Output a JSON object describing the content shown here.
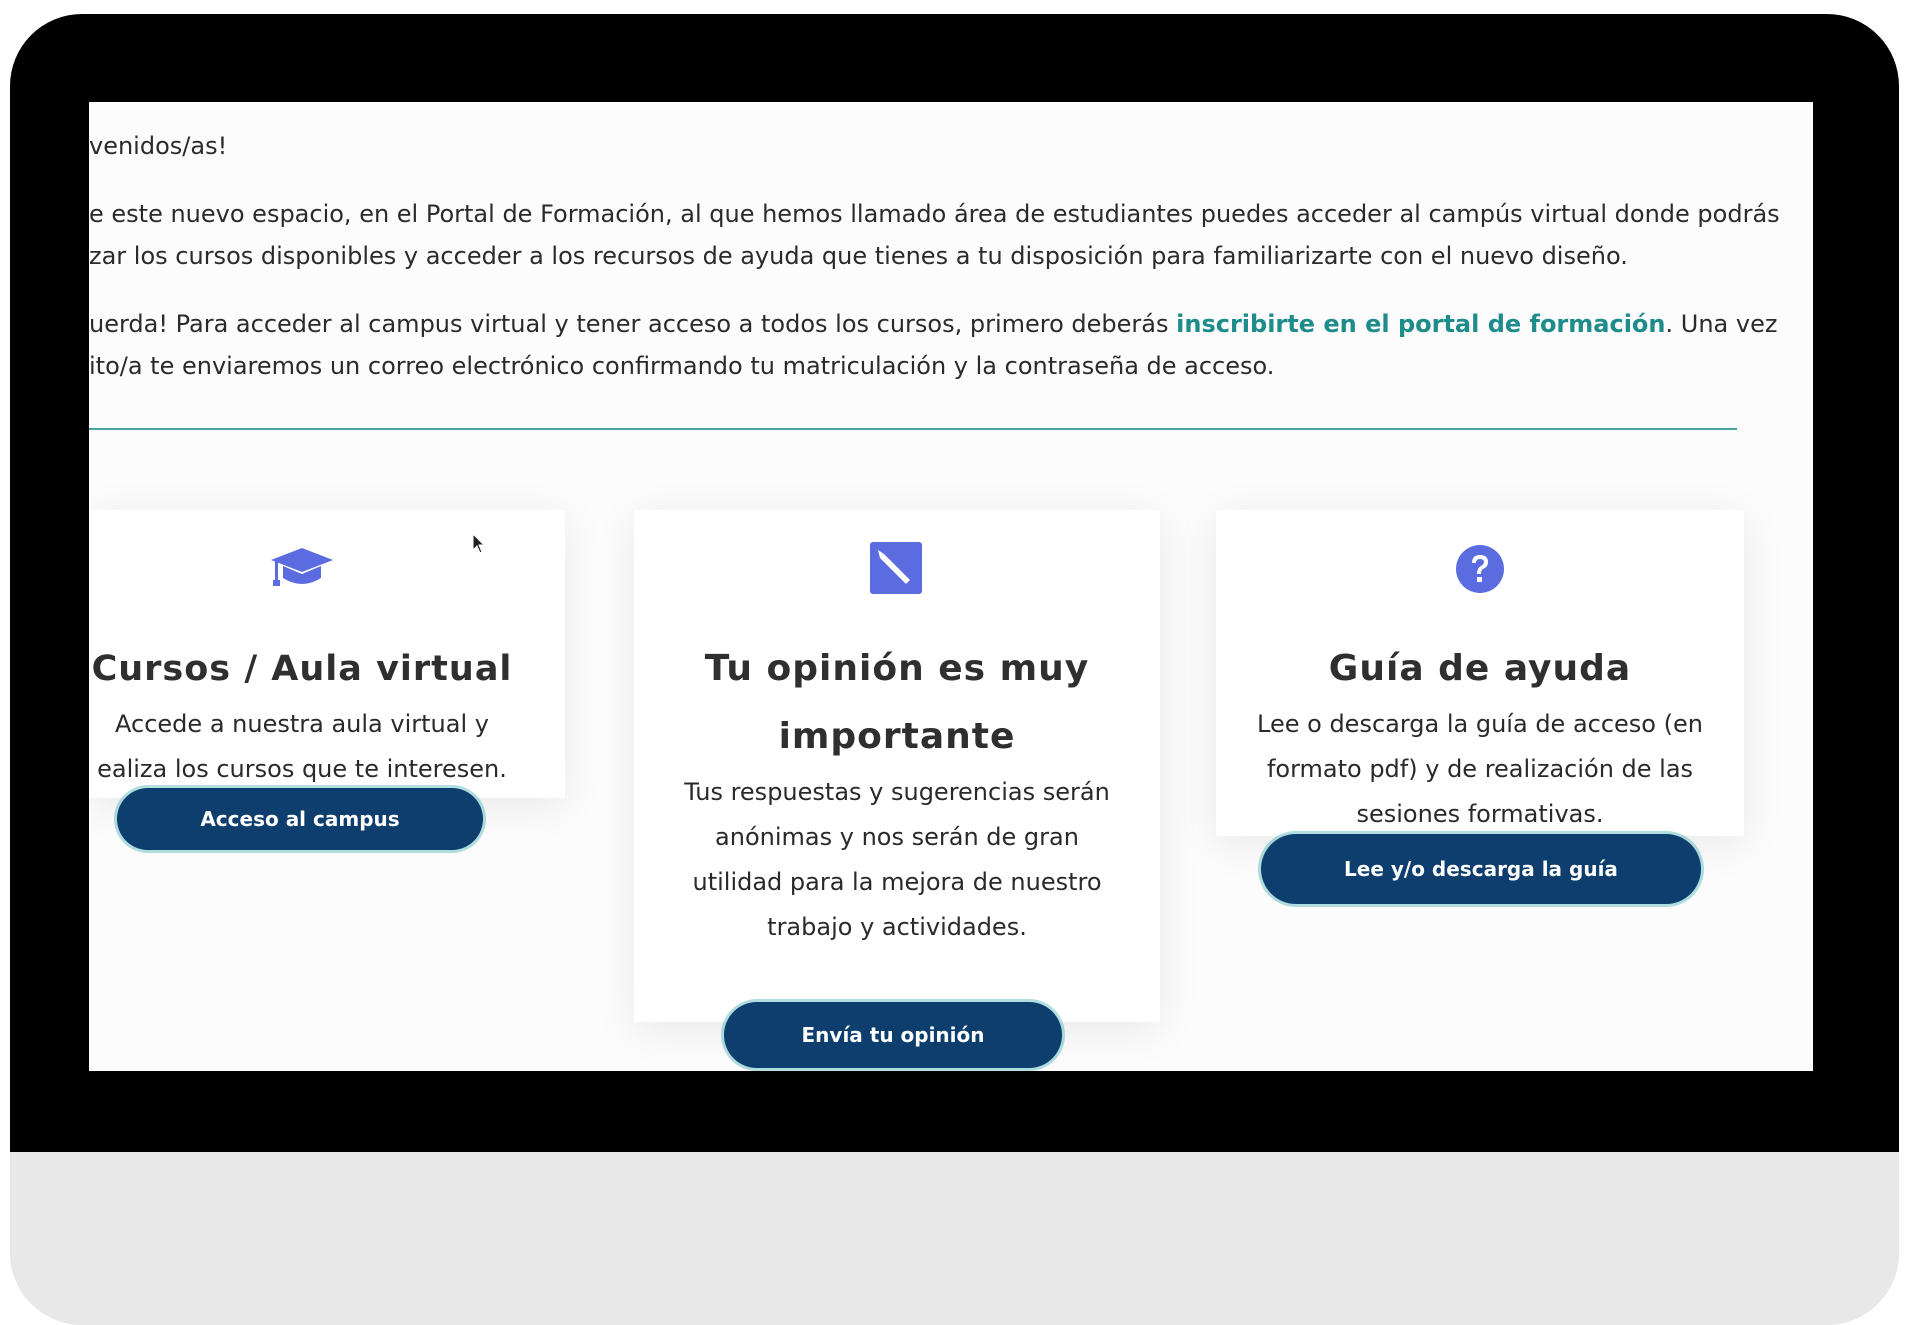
{
  "intro": {
    "welcome": "venidos/as!",
    "para1_line1": "e este nuevo espacio, en el Portal de Formación, al que hemos llamado área de estudiantes puedes acceder al campús virtual donde podrás",
    "para1_line2": "zar los cursos disponibles y acceder a los recursos de ayuda que tienes a tu disposición para familiarizarte con el nuevo diseño.",
    "para2_line1_before": "uerda! Para acceder al campus virtual y tener acceso a todos los cursos, primero deberás ",
    "para2_link": "inscribirte en el portal de formación",
    "para2_line1_after": ". Una vez",
    "para2_line2": "ito/a te enviaremos un correo electrónico confirmando tu matriculación y la contraseña de acceso."
  },
  "cards": [
    {
      "icon": "graduation-cap-icon",
      "title": "Cursos / Aula virtual",
      "text_line1": "Accede a nuestra aula virtual y",
      "text_line2": "ealiza los cursos que te interesen.",
      "button": "Acceso al campus"
    },
    {
      "icon": "pencil-square-icon",
      "title_line1": "Tu opinión es muy",
      "title_line2": "importante",
      "text_line1": "Tus respuestas y sugerencias serán",
      "text_line2": "anónimas y nos serán de gran",
      "text_line3": "utilidad para la mejora de nuestro",
      "text_line4": "trabajo y actividades.",
      "button": "Envía tu opinión"
    },
    {
      "icon": "question-circle-icon",
      "title": "Guía de ayuda",
      "text_line1": "Lee o descarga la guía de acceso (en",
      "text_line2": "formato pdf) y de realización de las",
      "text_line3": "sesiones formativas.",
      "button": "Lee y/o descarga la guía"
    }
  ],
  "colors": {
    "icon": "#5b6be0",
    "button": "#0d3e6e",
    "link": "#1f8c8c",
    "divider": "#4aa3a3"
  }
}
